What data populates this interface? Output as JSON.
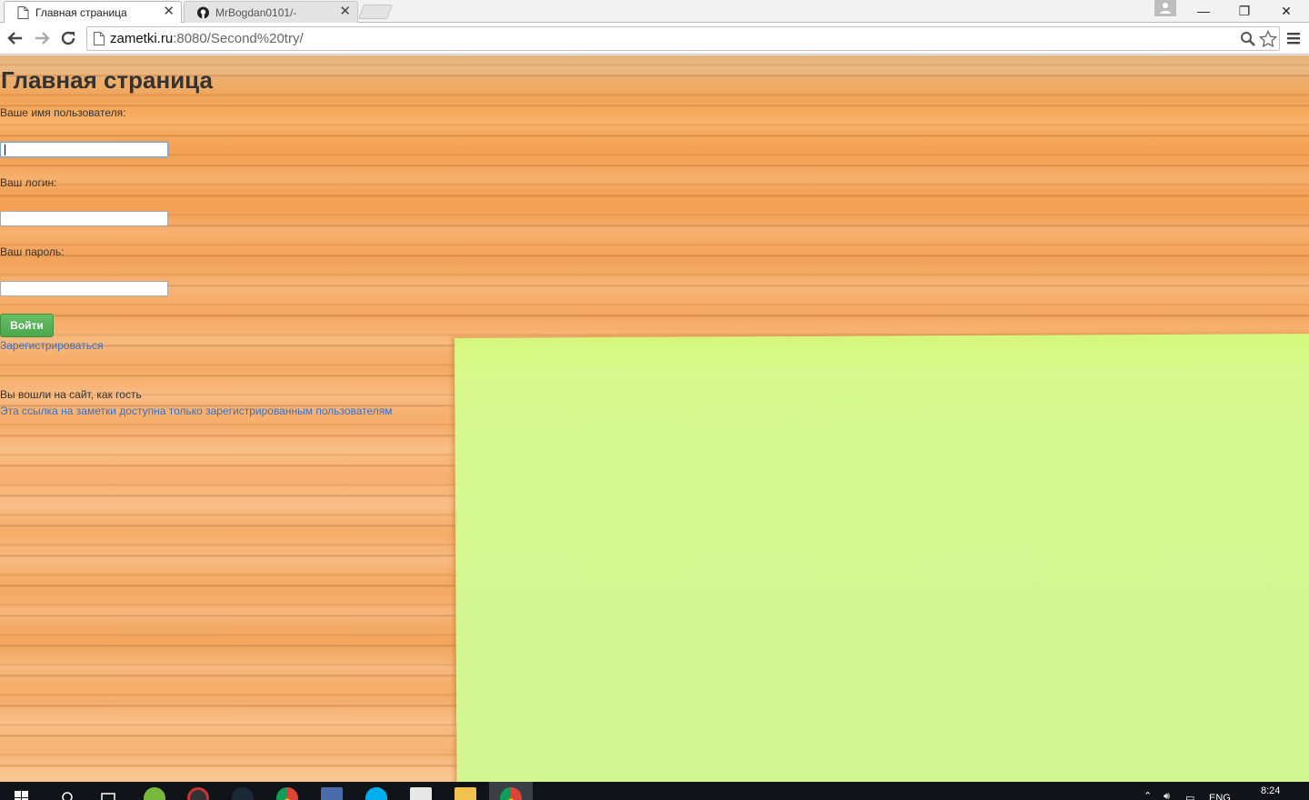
{
  "browser": {
    "tabs": [
      {
        "title": "Главная страница",
        "active": true,
        "favicon": "page-icon"
      },
      {
        "title": "MrBogdan0101/-",
        "active": false,
        "favicon": "github-icon"
      }
    ],
    "address_bar": {
      "host": "zametki.ru",
      "rest": ":8080/Second%20try/"
    },
    "window_controls": {
      "minimize": "—",
      "restore": "❐",
      "close": "✕"
    }
  },
  "page": {
    "title": "Главная страница",
    "username_label": "Ваше имя пользователя:",
    "username_value": "",
    "login_label": "Ваш логин:",
    "login_value": "",
    "password_label": "Ваш пароль:",
    "password_value": "",
    "login_button": "Войти",
    "register_link": "Зарегистрироваться",
    "guest_note": "Вы вошли на сайт, как гость",
    "notes_link": "Эта ссылка на заметки доступна только зарегистрированным пользователям"
  },
  "taskbar": {
    "apps": [
      "start-icon",
      "search-icon",
      "task-view-icon",
      "utorrent-icon",
      "media-icon",
      "steam-icon",
      "chrome-icon",
      "image-icon",
      "skype-icon",
      "notepad-icon",
      "folder-icon",
      "chrome-active-icon"
    ],
    "language": "ENG",
    "time": "8:24"
  },
  "colors": {
    "link": "#3a6fc4",
    "button": "#5cb85c",
    "sticky_note": "#d4f791",
    "wood": "#f6b06d"
  }
}
